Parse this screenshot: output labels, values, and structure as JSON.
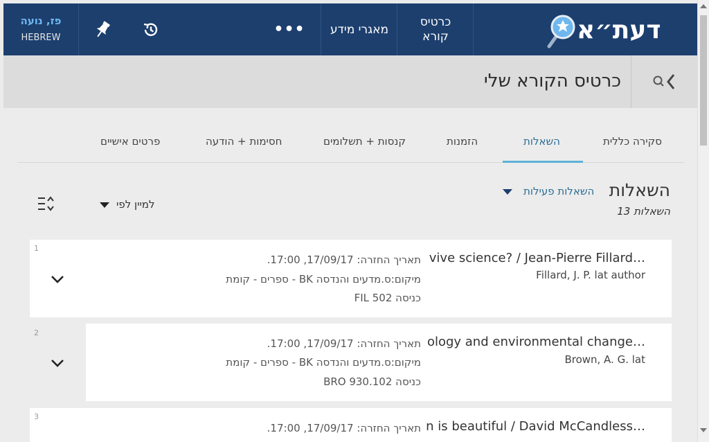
{
  "header": {
    "user_name": "פז, נועה",
    "language": "HEBREW",
    "more_label": "•••",
    "resources_label": "מאגרי מידע",
    "reader_card_label_line1": "כרטיס",
    "reader_card_label_line2": "קורא",
    "logo_text": "דעת״א",
    "brand_color": "#1c3f6e"
  },
  "subheader": {
    "page_title": "כרטיס הקורא שלי"
  },
  "tabs": [
    {
      "label": "סקירה כללית"
    },
    {
      "label": "השאלות"
    },
    {
      "label": "הזמנות"
    },
    {
      "label": "קנסות + תשלומים"
    },
    {
      "label": "חסימות + הודעה"
    },
    {
      "label": "פרטים אישיים"
    }
  ],
  "active_tab": "השאלות",
  "section": {
    "title": "השאלות",
    "count_label": "13 השאלות",
    "filter_label": "השאלות פעילות",
    "sort_label": "למיין לפי"
  },
  "loans": [
    {
      "index": "1",
      "title": "vive science? / Jean-Pierre Fillard…",
      "author": "Fillard, J. P. lat author",
      "due": "תאריך החזרה: 17/09/17, 17:00.",
      "location": "מיקום:ס.מדעים והנדסה BK - ספרים - קומת",
      "call_number": "כניסה FIL 502"
    },
    {
      "index": "2",
      "title": "ology and environmental change…",
      "author": "Brown, A. G. lat",
      "due": "תאריך החזרה: 17/09/17, 17:00.",
      "location": "מיקום:ס.מדעים והנדסה BK - ספרים - קומת",
      "call_number": "כניסה BRO 930.102"
    },
    {
      "index": "3",
      "title": "n is beautiful / David McCandless…",
      "author": "",
      "due": "תאריך החזרה: 17/09/17, 17:00.",
      "location": "",
      "call_number": ""
    }
  ]
}
